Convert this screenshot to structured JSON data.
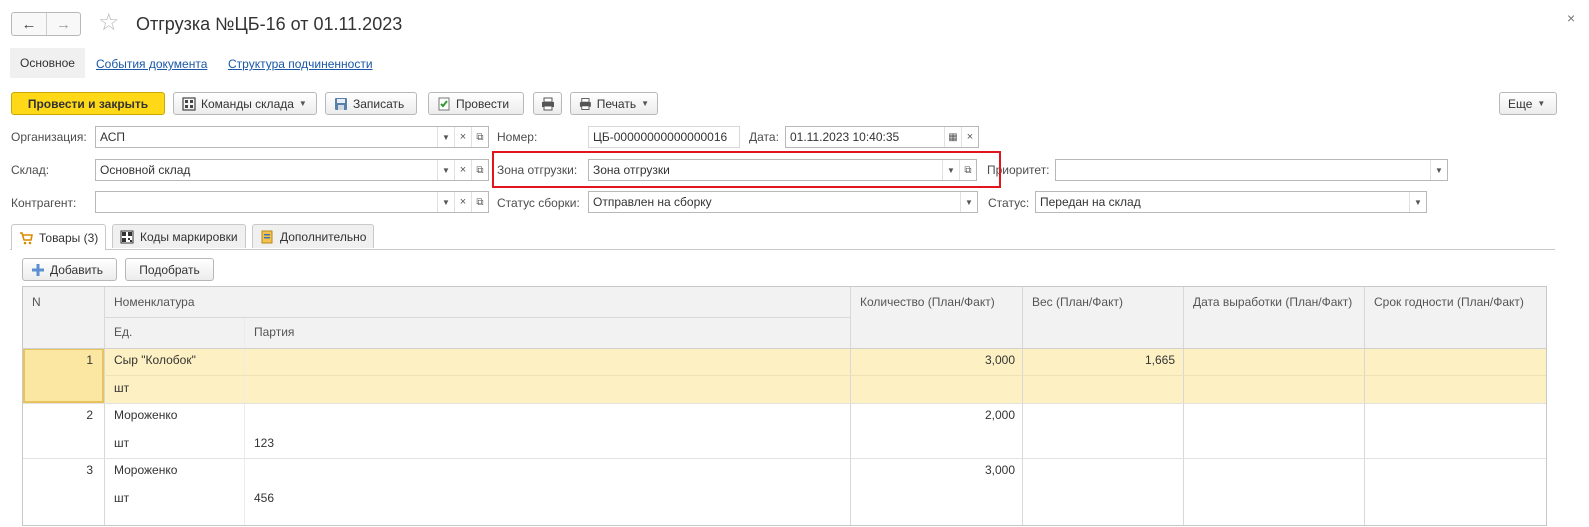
{
  "window": {
    "title": "Отгрузка №ЦБ-16 от 01.11.2023",
    "back_icon": "←",
    "forward_icon": "→",
    "star_icon": "☆",
    "close_icon": "×"
  },
  "sections": {
    "main": "Основное",
    "events": "События документа",
    "structure": "Структура подчиненности"
  },
  "toolbar": {
    "post_close": "Провести и закрыть",
    "warehouse_commands": "Команды склада",
    "save": "Записать",
    "post": "Провести",
    "print": "Печать",
    "more": "Еще"
  },
  "form": {
    "org_label": "Организация:",
    "org_value": "АСП",
    "number_label": "Номер:",
    "number_value": "ЦБ-00000000000000016",
    "date_label": "Дата:",
    "date_value": "01.11.2023 10:40:35",
    "warehouse_label": "Склад:",
    "warehouse_value": "Основной склад",
    "zone_label": "Зона отгрузки:",
    "zone_value": "Зона отгрузки",
    "priority_label": "Приоритет:",
    "priority_value": "",
    "counterparty_label": "Контрагент:",
    "counterparty_value": "",
    "assembly_status_label": "Статус сборки:",
    "assembly_status_value": "Отправлен на сборку",
    "status_label": "Статус:",
    "status_value": "Передан на склад"
  },
  "tabs": [
    {
      "label": "Товары (3)",
      "icon": "cart-icon"
    },
    {
      "label": "Коды маркировки",
      "icon": "qr-icon"
    },
    {
      "label": "Дополнительно",
      "icon": "document-icon"
    }
  ],
  "table_toolbar": {
    "add": "Добавить",
    "pick": "Подобрать"
  },
  "table": {
    "headers": {
      "n": "N",
      "nomenclature": "Номенклатура",
      "unit": "Ед.",
      "batch": "Партия",
      "qty": "Количество (План/Факт)",
      "weight": "Вес (План/Факт)",
      "prod_date": "Дата выработки (План/Факт)",
      "expiry": "Срок годности (План/Факт)"
    },
    "rows": [
      {
        "n": "1",
        "name": "Сыр \"Колобок\"",
        "unit": "шт",
        "batch": "",
        "qty": "3,000",
        "weight": "1,665",
        "prod_date": "",
        "expiry": ""
      },
      {
        "n": "2",
        "name": "Мороженко",
        "unit": "шт",
        "batch": "123",
        "qty": "2,000",
        "weight": "",
        "prod_date": "",
        "expiry": ""
      },
      {
        "n": "3",
        "name": "Мороженко",
        "unit": "шт",
        "batch": "456",
        "qty": "3,000",
        "weight": "",
        "prod_date": "",
        "expiry": ""
      }
    ]
  },
  "colors": {
    "accent_yellow": "#ffd817",
    "selected_row": "#fdf1c4",
    "highlight_red": "#e0161c",
    "link": "#1a57a6"
  }
}
